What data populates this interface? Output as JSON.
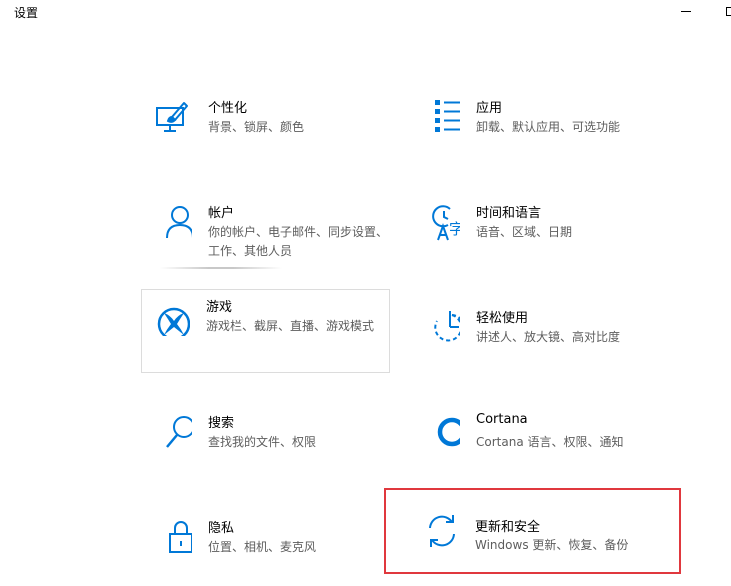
{
  "window": {
    "title": "设置"
  },
  "colors": {
    "accent": "#0078d7",
    "highlight_border": "#e0383e",
    "description_text": "#5d5d5d"
  },
  "tiles": [
    {
      "id": "personalization",
      "title": "个性化",
      "description": "背景、锁屏、颜色",
      "icon": "personalization-icon"
    },
    {
      "id": "apps",
      "title": "应用",
      "description": "卸载、默认应用、可选功能",
      "icon": "apps-icon"
    },
    {
      "id": "accounts",
      "title": "帐户",
      "description": "你的帐户、电子邮件、同步设置、工作、其他人员",
      "icon": "person-icon"
    },
    {
      "id": "time-language",
      "title": "时间和语言",
      "description": "语音、区域、日期",
      "icon": "time-language-icon"
    },
    {
      "id": "gaming",
      "title": "游戏",
      "description": "游戏栏、截屏、直播、游戏模式",
      "icon": "xbox-icon"
    },
    {
      "id": "ease-of-access",
      "title": "轻松使用",
      "description": "讲述人、放大镜、高对比度",
      "icon": "ease-of-access-icon"
    },
    {
      "id": "search",
      "title": "搜索",
      "description": "查找我的文件、权限",
      "icon": "search-icon"
    },
    {
      "id": "cortana",
      "title": "Cortana",
      "description": "Cortana 语言、权限、通知",
      "icon": "cortana-icon"
    },
    {
      "id": "privacy",
      "title": "隐私",
      "description": "位置、相机、麦克风",
      "icon": "lock-icon"
    },
    {
      "id": "update-security",
      "title": "更新和安全",
      "description": "Windows 更新、恢复、备份",
      "icon": "sync-icon"
    }
  ]
}
